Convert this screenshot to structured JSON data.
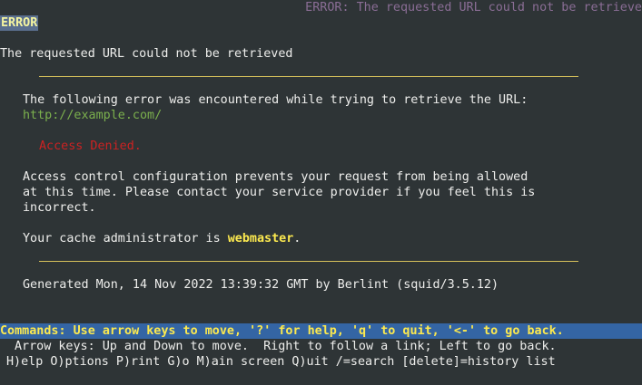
{
  "window": {
    "title_right": "ERROR: The requested URL could not be retrieve"
  },
  "page": {
    "tag": "ERROR",
    "heading": "The requested URL could not be retrieved",
    "error_intro": "The following error was encountered while trying to retrieve the URL:",
    "url": "http://example.com/",
    "denied": "Access Denied.",
    "explanation": [
      "Access control configuration prevents your request from being allowed",
      "at this time. Please contact your service provider if you feel this is",
      "incorrect."
    ],
    "admin_prefix": "Your cache administrator is ",
    "admin_link": "webmaster",
    "admin_suffix": ".",
    "generated": "Generated Mon, 14 Nov 2022 13:39:32 GMT by Berlint (squid/3.5.12)"
  },
  "status": {
    "commands": "Commands: Use arrow keys to move, '?' for help, 'q' to quit, '<-' to go back.",
    "arrow_help": "Arrow keys: Up and Down to move.  Right to follow a link; Left to go back.",
    "shortcuts": "H)elp O)ptions P)rint G)o M)ain screen Q)uit /=search [delete]=history list"
  },
  "colors": {
    "background": "#2e3436",
    "link": "#7bb04d",
    "denied": "#cc2222",
    "highlight": "#fce94f",
    "command_bar": "#3465a4",
    "rule": "#d7c15b"
  }
}
